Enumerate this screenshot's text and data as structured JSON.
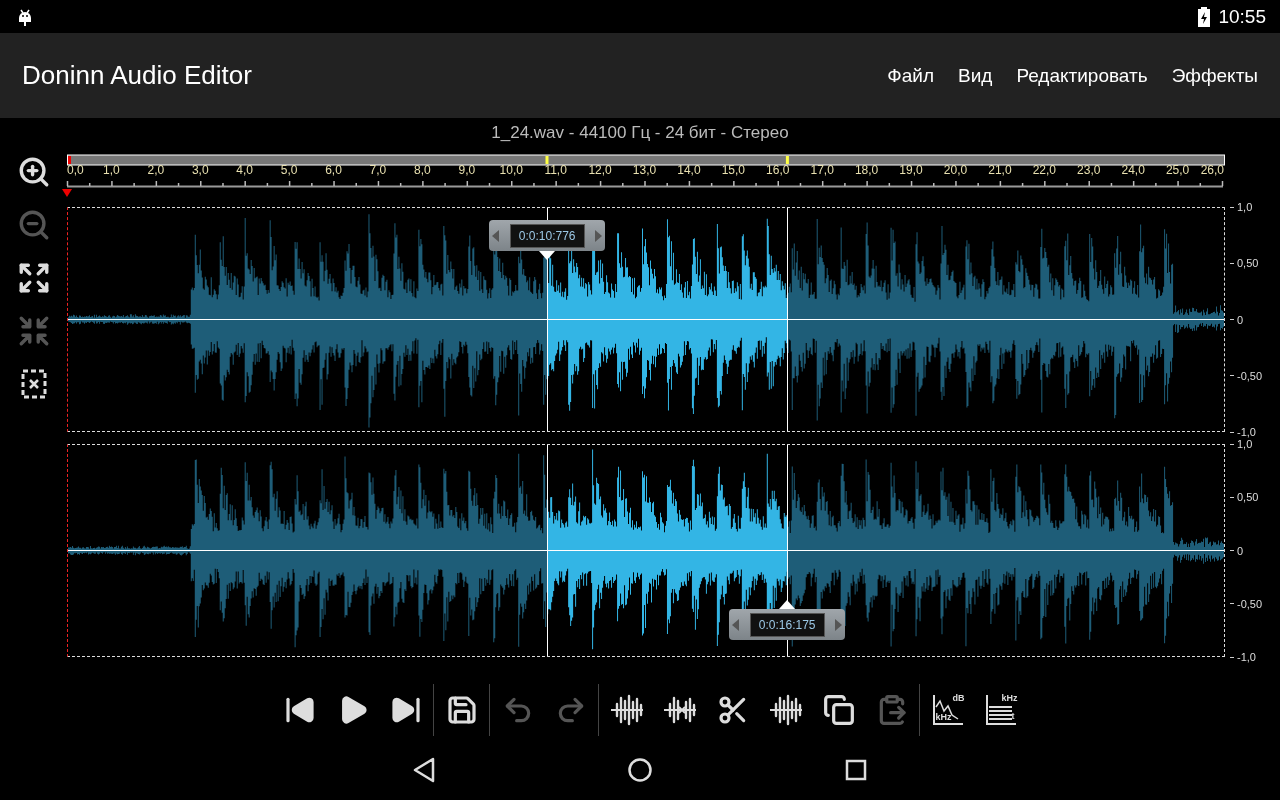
{
  "status_bar": {
    "time": "10:55"
  },
  "app_bar": {
    "title": "Doninn Audio Editor",
    "menu": [
      "Файл",
      "Вид",
      "Редактировать",
      "Эффекты"
    ]
  },
  "file_info": "1_24.wav - 44100 Гц - 24 бит - Стерео",
  "side_tools": [
    {
      "kind": "zoom-in",
      "disabled": false
    },
    {
      "kind": "zoom-out",
      "disabled": true
    },
    {
      "kind": "expand",
      "disabled": false
    },
    {
      "kind": "shrink",
      "disabled": true
    },
    {
      "kind": "deselect",
      "disabled": false
    }
  ],
  "timeline": {
    "ticks": [
      "0,0",
      "1,0",
      "2,0",
      "3,0",
      "4,0",
      "5,0",
      "6,0",
      "7,0",
      "8,0",
      "9,0",
      "10,0",
      "11,0",
      "12,0",
      "13,0",
      "14,0",
      "15,0",
      "16,0",
      "17,0",
      "18,0",
      "19,0",
      "20,0",
      "21,0",
      "22,0",
      "23,0",
      "24,0",
      "25,0",
      "26,0"
    ],
    "playhead": {
      "level": 0
    },
    "selection_start": {
      "level": 0.4145,
      "time": "0:0:10:776"
    },
    "selection_end": {
      "level": 0.6221,
      "time": "0:0:16:175"
    }
  },
  "channels": [
    {
      "axis": [
        "1,0",
        "0,50",
        "0",
        "-0,50",
        "-1,0"
      ],
      "tooltip": {
        "kind": "start"
      }
    },
    {
      "axis": [
        "1,0",
        "0,50",
        "0",
        "-0,50",
        "-1,0"
      ],
      "tooltip": {
        "kind": "end"
      }
    }
  ],
  "toolbar": [
    [
      {
        "kind": "skip-back",
        "disabled": false
      },
      {
        "kind": "play",
        "disabled": false
      },
      {
        "kind": "skip-forward",
        "disabled": false
      }
    ],
    [
      {
        "kind": "save",
        "disabled": false
      }
    ],
    [
      {
        "kind": "undo",
        "disabled": true
      },
      {
        "kind": "redo",
        "disabled": true
      }
    ],
    [
      {
        "kind": "trim",
        "disabled": false
      },
      {
        "kind": "delete",
        "disabled": false
      },
      {
        "kind": "cut",
        "disabled": false
      },
      {
        "kind": "silence",
        "disabled": false
      },
      {
        "kind": "copy",
        "disabled": false
      },
      {
        "kind": "paste",
        "disabled": true
      }
    ],
    [
      {
        "kind": "spectrum",
        "disabled": false,
        "icon_texts": [
          "dB",
          "kHz"
        ]
      },
      {
        "kind": "spectrogram",
        "disabled": false,
        "icon_texts": [
          "kHz",
          "t"
        ]
      }
    ]
  ],
  "nav_bar": [
    {
      "kind": "back"
    },
    {
      "kind": "home"
    },
    {
      "kind": "recents"
    }
  ]
}
